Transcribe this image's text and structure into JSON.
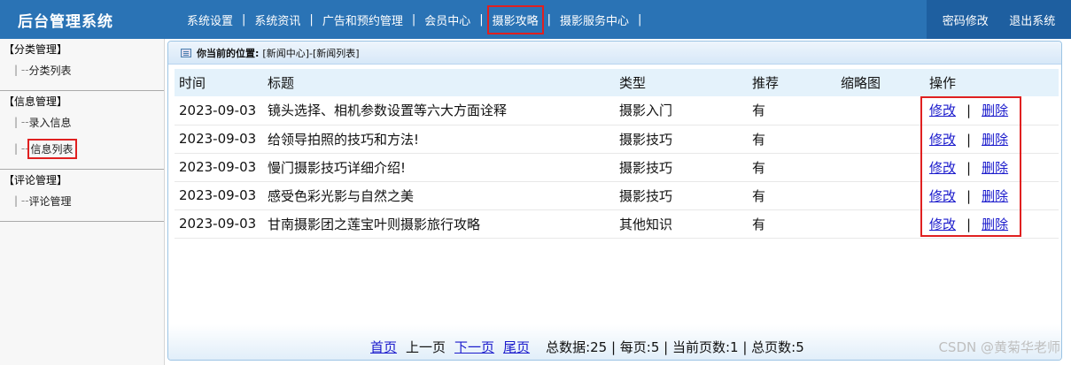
{
  "header": {
    "title": "后台管理系统",
    "nav": [
      {
        "label": "系统设置"
      },
      {
        "label": "系统资讯"
      },
      {
        "label": "广告和预约管理"
      },
      {
        "label": "会员中心"
      },
      {
        "label": "摄影攻略"
      },
      {
        "label": "摄影服务中心"
      }
    ],
    "change_password": "密码修改",
    "logout": "退出系统"
  },
  "sidebar": {
    "groups": [
      {
        "title": "【分类管理】",
        "items": [
          {
            "prefix": "| --",
            "label": "分类列表"
          }
        ]
      },
      {
        "title": "【信息管理】",
        "items": [
          {
            "prefix": "| --",
            "label": "录入信息"
          },
          {
            "prefix": "| --",
            "label": "信息列表"
          }
        ]
      },
      {
        "title": "【评论管理】",
        "items": [
          {
            "prefix": "| --",
            "label": "评论管理"
          }
        ]
      }
    ]
  },
  "breadcrumb": {
    "label": "你当前的位置:",
    "path": "[新闻中心]-[新闻列表]"
  },
  "table": {
    "headers": [
      "时间",
      "标题",
      "类型",
      "推荐",
      "缩略图",
      "操作"
    ],
    "rows": [
      {
        "time": "2023-09-03",
        "title": "镜头选择、相机参数设置等六大方面诠释",
        "type": "摄影入门",
        "recommend": "有",
        "thumb": "",
        "edit": "修改",
        "sep": "|",
        "delete": "删除"
      },
      {
        "time": "2023-09-03",
        "title": "给领导拍照的技巧和方法!",
        "type": "摄影技巧",
        "recommend": "有",
        "thumb": "",
        "edit": "修改",
        "sep": "|",
        "delete": "删除"
      },
      {
        "time": "2023-09-03",
        "title": "慢门摄影技巧详细介绍!",
        "type": "摄影技巧",
        "recommend": "有",
        "thumb": "",
        "edit": "修改",
        "sep": "|",
        "delete": "删除"
      },
      {
        "time": "2023-09-03",
        "title": "感受色彩光影与自然之美",
        "type": "摄影技巧",
        "recommend": "有",
        "thumb": "",
        "edit": "修改",
        "sep": "|",
        "delete": "删除"
      },
      {
        "time": "2023-09-03",
        "title": "甘南摄影团之莲宝叶则摄影旅行攻略",
        "type": "其他知识",
        "recommend": "有",
        "thumb": "",
        "edit": "修改",
        "sep": "|",
        "delete": "删除"
      }
    ]
  },
  "pager": {
    "first": "首页",
    "prev": "上一页",
    "next": "下一页",
    "last": "尾页",
    "info": "总数据:25 | 每页:5 | 当前页数:1 | 总页数:5"
  },
  "watermark": "CSDN @黄菊华老师",
  "colors": {
    "header_bg": "#2a73b5",
    "highlight_border": "#e02020",
    "link": "#1a1acc"
  },
  "icons": {
    "breadcrumb": "list-icon"
  }
}
